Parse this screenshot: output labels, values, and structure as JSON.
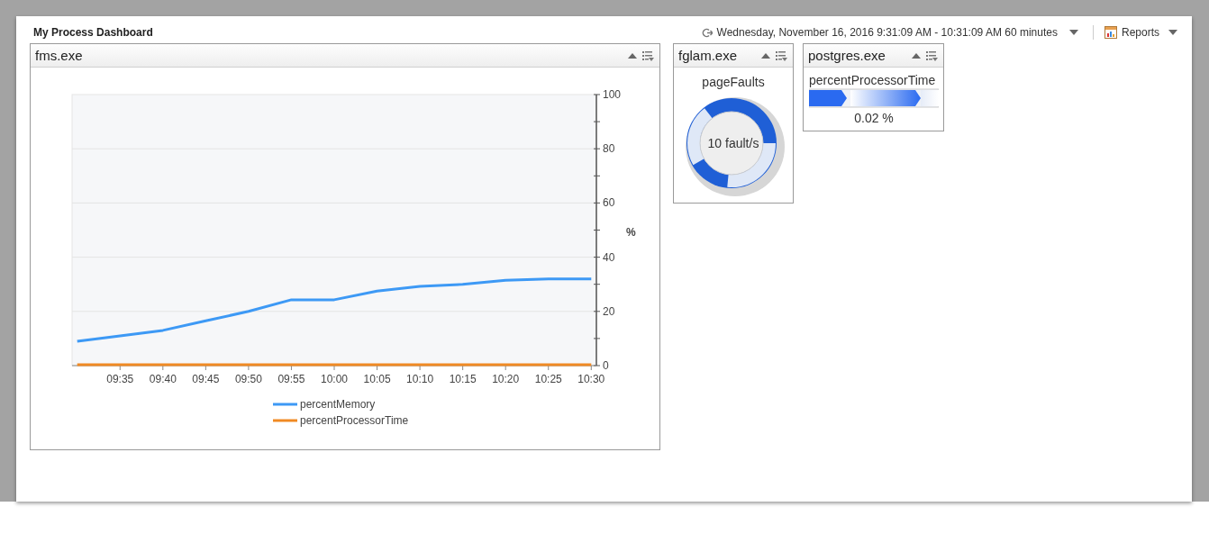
{
  "dashboard": {
    "title": "My Process Dashboard",
    "time_range": "Wednesday, November 16, 2016 9:31:09 AM - 10:31:09 AM 60 minutes",
    "reports_label": "Reports"
  },
  "portlets": [
    {
      "kind": "chart",
      "title": "fms.exe",
      "chart_data": {
        "type": "line",
        "ylabel": "%",
        "categories": [
          null,
          "09:35",
          "09:40",
          "09:45",
          "09:50",
          "09:55",
          "10:00",
          "10:05",
          "10:10",
          "10:15",
          "10:20",
          "10:25",
          "10:30"
        ],
        "series": [
          {
            "name": "percentMemory",
            "color": "#3d99f5",
            "values": [
              9,
              11,
              13,
              16.5,
              20,
              24.3,
              24.3,
              27.5,
              29.2,
              30,
              31.5,
              32,
              32
            ]
          },
          {
            "name": "percentProcessorTime",
            "color": "#f08a24",
            "values": [
              0.3,
              0.3,
              0.3,
              0.3,
              0.3,
              0.3,
              0.3,
              0.3,
              0.3,
              0.3,
              0.3,
              0.3,
              0.3
            ]
          }
        ],
        "ylim": [
          0,
          100
        ],
        "grid": true,
        "legend": "bottom",
        "yticks": [
          0,
          20,
          40,
          60,
          80,
          100
        ]
      }
    },
    {
      "kind": "gauge",
      "title": "fglam.exe",
      "metric": "pageFaults",
      "reading": "10 fault/s"
    },
    {
      "kind": "bar",
      "title": "postgres.exe",
      "metric": "percentProcessorTime",
      "reading": "0.02 %"
    }
  ]
}
